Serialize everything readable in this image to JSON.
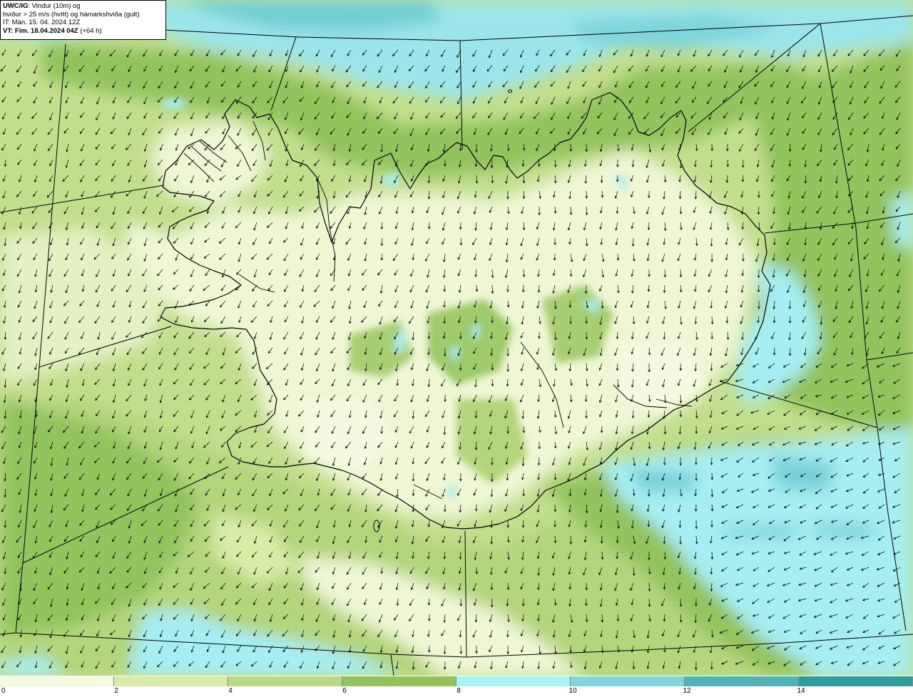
{
  "header": {
    "model": "UWC/IG",
    "title_rest": ": Vindur (10m) og",
    "line2": "hviður > 25 m/s (hvítt) og hámarkshviða (gult)",
    "line3": "IT: Mán. 15. 04. 2024 12Z",
    "vt_label": "VT: Fim. 18.04.2024 04Z",
    "vt_lead": " (+64 h)"
  },
  "legend": {
    "labels": [
      "0",
      "2",
      "4",
      "6",
      "8",
      "10",
      "12",
      "14"
    ],
    "colors": [
      "#f4fadf",
      "#d8eca6",
      "#b9da82",
      "#95c25b",
      "#a9f2f6",
      "#80d6dc",
      "#4fb3b8",
      "#2f9da0"
    ]
  },
  "map": {
    "land_outline": "#000000",
    "arrow_color": "#000000",
    "grid_color": "#000000"
  }
}
